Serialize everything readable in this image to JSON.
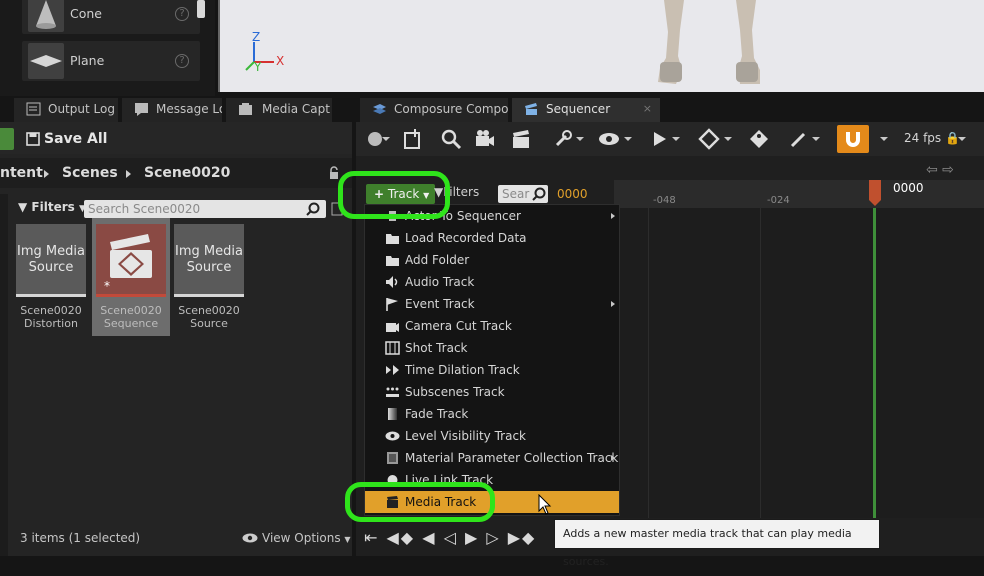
{
  "place_panel": {
    "items": [
      {
        "label": "Cone",
        "icon": "cone-icon"
      },
      {
        "label": "Plane",
        "icon": "plane-icon"
      }
    ],
    "help_glyph": "?"
  },
  "viewport": {
    "axis_z": "Z",
    "axis_y": "Y",
    "axis_x": "X"
  },
  "tabs": [
    {
      "label": "Output Log",
      "icon": "output-log-icon"
    },
    {
      "label": "Message Lo",
      "icon": "message-log-icon"
    },
    {
      "label": "Media Capt",
      "icon": "media-capture-icon"
    },
    {
      "label": "Composure Compo",
      "icon": "composure-icon"
    },
    {
      "label": "Sequencer",
      "icon": "sequencer-icon",
      "active": true
    }
  ],
  "content_browser": {
    "save_all": "Save All",
    "breadcrumb": [
      "ntent",
      "Scenes",
      "Scene0020"
    ],
    "filters": "Filters",
    "search_placeholder": "Search Scene0020",
    "assets": [
      {
        "thumb_text": "Img Media Source",
        "name": "Scene0020 Distortion"
      },
      {
        "thumb_text": "",
        "name": "Scene0020 Sequence",
        "selected": true
      },
      {
        "thumb_text": "Img Media Source",
        "name": "Scene0020 Source"
      }
    ],
    "status": "3 items (1 selected)",
    "view_options": "View Options"
  },
  "sequencer": {
    "fps": "24 fps",
    "track_button": "Track",
    "filters": "Filters",
    "search_placeholder": "Sear",
    "current_time": "0000",
    "ruler": [
      "-048",
      "-024"
    ],
    "playhead_label": "0000",
    "menu": [
      {
        "label": "Actor To Sequencer",
        "icon": "actor-icon",
        "submenu": true
      },
      {
        "label": "Load Recorded Data",
        "icon": "folder-icon"
      },
      {
        "label": "Add Folder",
        "icon": "folder-icon"
      },
      {
        "label": "Audio Track",
        "icon": "audio-icon"
      },
      {
        "label": "Event Track",
        "icon": "event-flag-icon",
        "submenu": true
      },
      {
        "label": "Camera Cut Track",
        "icon": "camera-cut-icon"
      },
      {
        "label": "Shot Track",
        "icon": "shot-icon"
      },
      {
        "label": "Time Dilation Track",
        "icon": "time-dilation-icon"
      },
      {
        "label": "Subscenes Track",
        "icon": "subscenes-icon"
      },
      {
        "label": "Fade Track",
        "icon": "fade-icon"
      },
      {
        "label": "Level Visibility Track",
        "icon": "eye-icon"
      },
      {
        "label": "Material Parameter Collection Track",
        "icon": "material-icon",
        "submenu": true
      },
      {
        "label": "Live Link Track",
        "icon": "live-link-icon"
      },
      {
        "label": "Media Track",
        "icon": "media-track-icon",
        "highlighted": true
      }
    ],
    "tooltip": "Adds a new master media track that can play media sources."
  },
  "colors": {
    "accent_orange": "#e1a02a",
    "highlight_ring": "#2fe41b",
    "track_green": "#3f7f2c"
  }
}
